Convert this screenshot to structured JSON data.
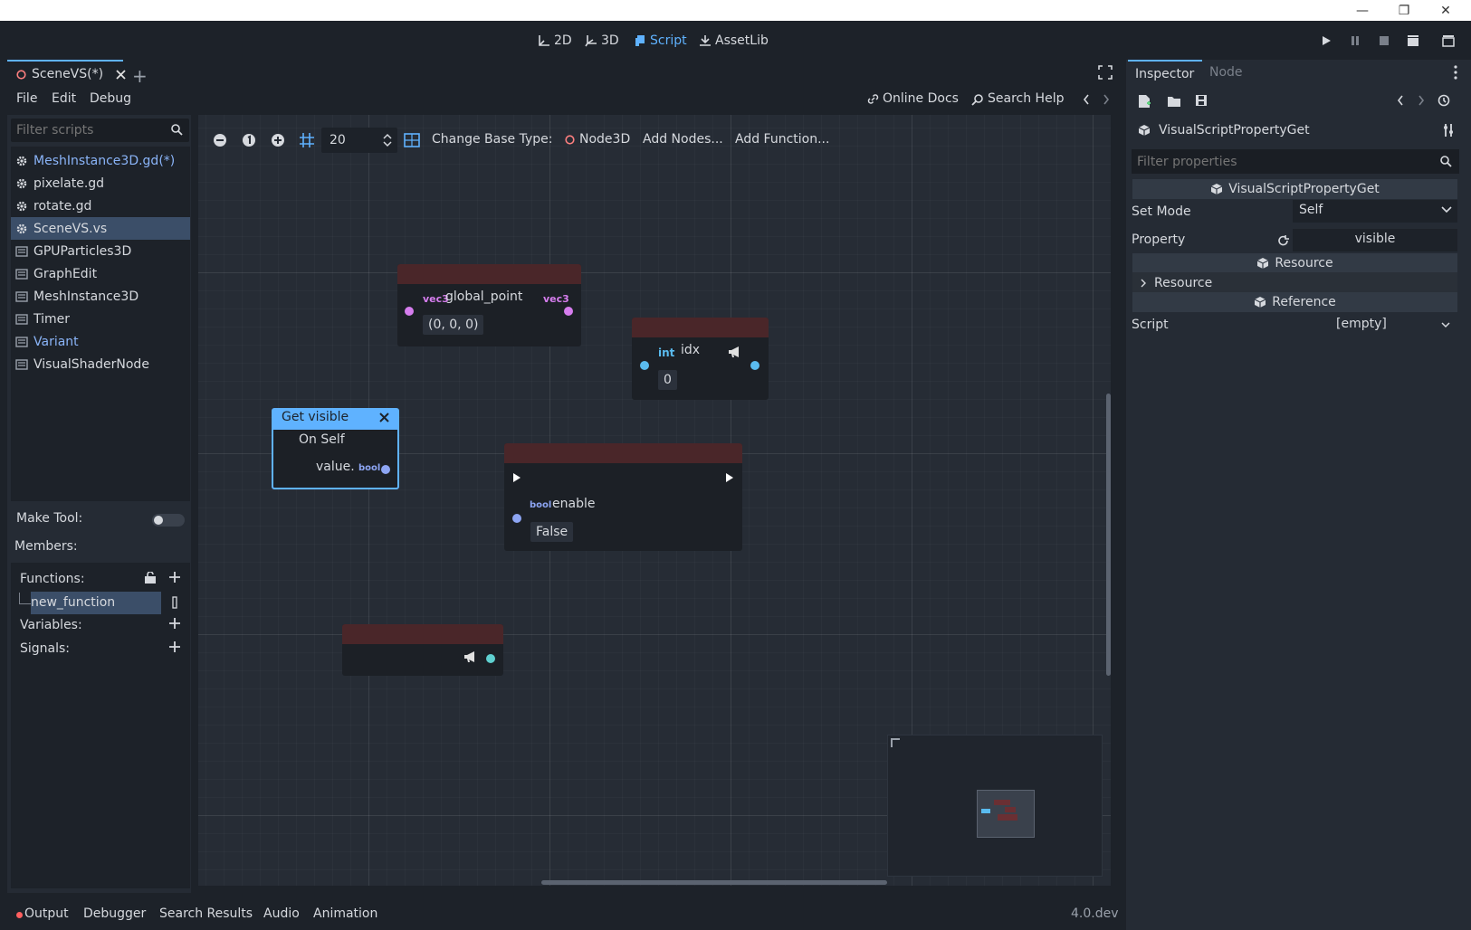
{
  "window_controls": {
    "minimize": "—",
    "restore": "❐",
    "close": "✕"
  },
  "main_buttons": [
    {
      "label": "2D",
      "active": false
    },
    {
      "label": "3D",
      "active": false
    },
    {
      "label": "Script",
      "active": true
    },
    {
      "label": "AssetLib",
      "active": false
    }
  ],
  "script_tab": {
    "label": "SceneVS(*)",
    "add": "+"
  },
  "menu": {
    "file": "File",
    "edit": "Edit",
    "debug": "Debug",
    "online_docs": "Online Docs",
    "search_help": "Search Help"
  },
  "filter_scripts": {
    "placeholder": "Filter scripts"
  },
  "scripts": [
    {
      "label": "MeshInstance3D.gd(*)",
      "icon": "gear-icon",
      "state": "modified"
    },
    {
      "label": "pixelate.gd",
      "icon": "gear-icon",
      "state": "normal"
    },
    {
      "label": "rotate.gd",
      "icon": "gear-icon",
      "state": "normal"
    },
    {
      "label": "SceneVS.vs",
      "icon": "visual-script-icon",
      "state": "selected"
    },
    {
      "label": "GPUParticles3D",
      "icon": "doc-icon",
      "state": "normal"
    },
    {
      "label": "GraphEdit",
      "icon": "doc-icon",
      "state": "normal"
    },
    {
      "label": "MeshInstance3D",
      "icon": "doc-icon",
      "state": "normal"
    },
    {
      "label": "Timer",
      "icon": "doc-icon",
      "state": "normal"
    },
    {
      "label": "Variant",
      "icon": "doc-icon",
      "state": "blue"
    },
    {
      "label": "VisualShaderNode",
      "icon": "doc-icon",
      "state": "normal"
    }
  ],
  "make_tool": {
    "label": "Make Tool:",
    "on": false
  },
  "members": {
    "label": "Members:",
    "functions": "Functions:",
    "function_item": "new_function",
    "variables": "Variables:",
    "signals": "Signals:"
  },
  "graph_toolbar": {
    "snap_value": "20",
    "change_base_type_label": "Change Base Type:",
    "base_type": "Node3D",
    "add_nodes": "Add Nodes...",
    "add_function": "Add Function..."
  },
  "nodes": {
    "global_point": {
      "type_icon": "vec3",
      "label": "global_point",
      "value": "(0, 0, 0)"
    },
    "idx": {
      "type_icon": "int",
      "label": "idx",
      "value": "0"
    },
    "get_visible": {
      "title": "Get visible",
      "subtitle": "On Self",
      "output_label": "value.",
      "output_type": "bool"
    },
    "enable": {
      "type_icon": "bool",
      "label": "enable",
      "value": "False"
    }
  },
  "inspector": {
    "tab_inspector": "Inspector",
    "tab_node": "Node",
    "object_name": "VisualScriptPropertyGet",
    "filter_placeholder": "Filter properties",
    "class_header": "VisualScriptPropertyGet",
    "set_mode_label": "Set Mode",
    "set_mode_value": "Self",
    "property_label": "Property",
    "property_value": "visible",
    "section_resource": "Resource",
    "resource_group": "Resource",
    "section_reference": "Reference",
    "script_label": "Script",
    "script_value": "[empty]"
  },
  "bottom_tabs": [
    "Output",
    "Debugger",
    "Search Results",
    "Audio",
    "Animation"
  ],
  "version": "4.0.dev",
  "colors": {
    "accent": "#5fb2ff",
    "node_header": "#4a2629",
    "vec3_pin": "#d67dee",
    "int_pin": "#5abbef",
    "bool_pin": "#8da5f3",
    "exec_pin": "#ffffff",
    "output_dot": "#ff5f5f"
  }
}
